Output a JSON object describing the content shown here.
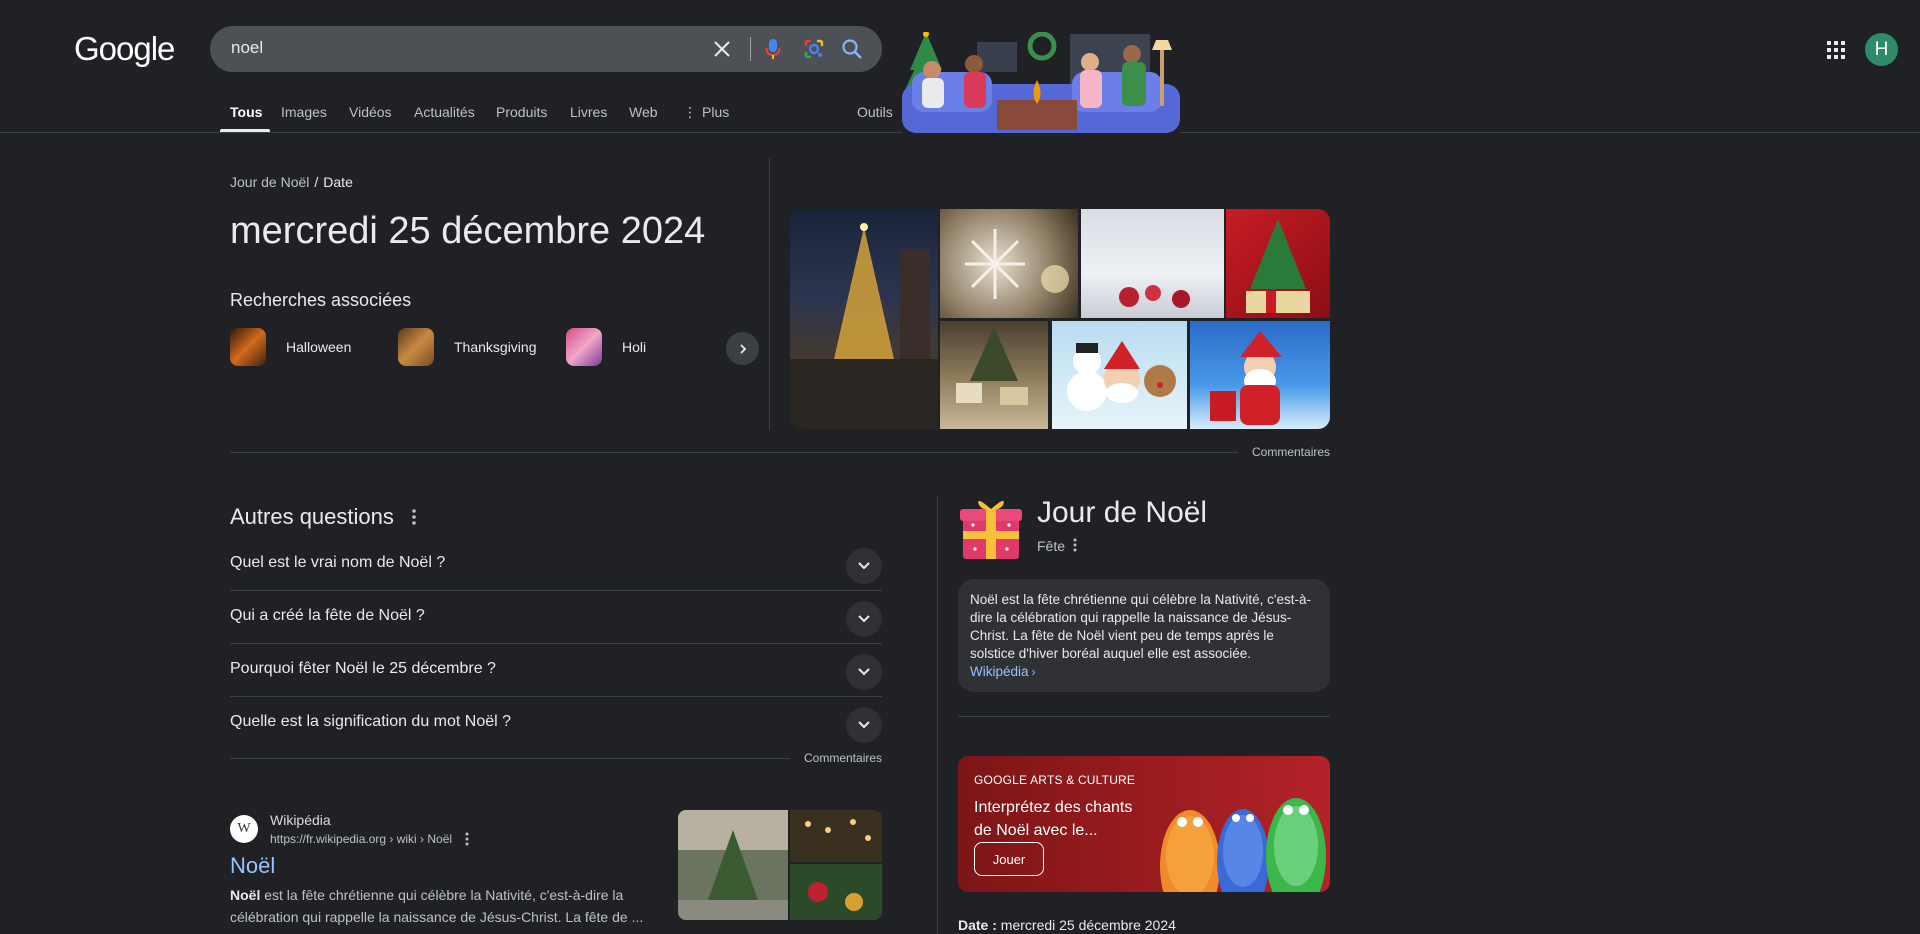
{
  "header": {
    "logo": "Google",
    "search": {
      "value": "noel"
    },
    "account_initial": "H"
  },
  "tabs": [
    {
      "label": "Tous",
      "active": true
    },
    {
      "label": "Images"
    },
    {
      "label": "Vidéos"
    },
    {
      "label": "Actualités"
    },
    {
      "label": "Produits"
    },
    {
      "label": "Livres"
    },
    {
      "label": "Web"
    },
    {
      "label": "Plus"
    }
  ],
  "tools_label": "Outils",
  "answer": {
    "breadcrumb_parent": "Jour de Noël",
    "breadcrumb_current": "Date",
    "title": "mercredi 25 décembre 2024",
    "related_title": "Recherches associées",
    "related": [
      {
        "label": "Halloween"
      },
      {
        "label": "Thanksgiving"
      },
      {
        "label": "Holi"
      }
    ],
    "feedback": "Commentaires"
  },
  "paa": {
    "title": "Autres questions",
    "questions": [
      "Quel est le vrai nom de Noël ?",
      "Qui a créé la fête de Noël ?",
      "Pourquoi fêter Noël le 25 décembre ?",
      "Quelle est la signification du mot Noël ?"
    ],
    "feedback": "Commentaires"
  },
  "result": {
    "favicon_letter": "W",
    "site": "Wikipédia",
    "url": "https://fr.wikipedia.org › wiki › Noël",
    "title": "Noël",
    "snippet_bold": "Noël",
    "snippet_rest": " est la fête chrétienne qui célèbre la Nativité, c'est-à-dire la célébration qui rappelle la naissance de Jésus-Christ. La fête de ..."
  },
  "knowledge_panel": {
    "title": "Jour de Noël",
    "subtitle": "Fête",
    "description": "Noël est la fête chrétienne qui célèbre la Nativité, c'est-à-dire la célébration qui rappelle la naissance de Jésus-Christ. La fête de Noël vient peu de temps après le solstice d'hiver boréal auquel elle est associée.",
    "source_link": "Wikipédia",
    "card": {
      "source": "GOOGLE ARTS & CULTURE",
      "text": "Interprétez des chants de Noël avec le...",
      "button": "Jouer"
    },
    "date_label": "Date :",
    "date_value": "mercredi 25 décembre 2024"
  }
}
